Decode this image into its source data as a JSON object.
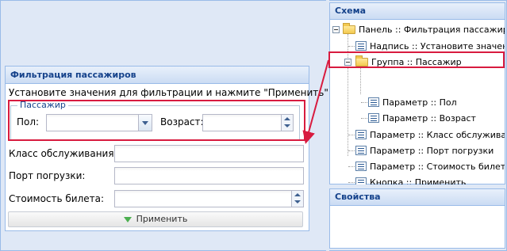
{
  "filter_panel": {
    "title": "Фильтрация пассажиров",
    "instruction": "Установите значения для фильтрации и нажмите \"Применить\"",
    "group_legend": "Пассажир",
    "gender_label": "Пол:",
    "gender_value": "",
    "age_label": "Возраст:",
    "age_value": "",
    "class_label": "Класс обслуживания:",
    "class_value": "",
    "port_label": "Порт погрузки:",
    "port_value": "",
    "fare_label": "Стоимость билета:",
    "fare_value": "",
    "apply_label": "Применить"
  },
  "schema": {
    "title": "Схема",
    "nodes": [
      "Панель :: Фильтрация пассажиров",
      "Надпись :: Установите значения д",
      "Группа :: Пассажир",
      "Параметр :: Пол",
      "Параметр :: Возраст",
      "Параметр :: Класс обслуживания",
      "Параметр :: Порт погрузки",
      "Параметр :: Стоимость билета",
      "Кнопка :: Применить"
    ]
  },
  "properties": {
    "title": "Свойства"
  },
  "colors": {
    "highlight": "#d81b3f",
    "header_text": "#15428b",
    "apply_icon": "#4caf50"
  }
}
